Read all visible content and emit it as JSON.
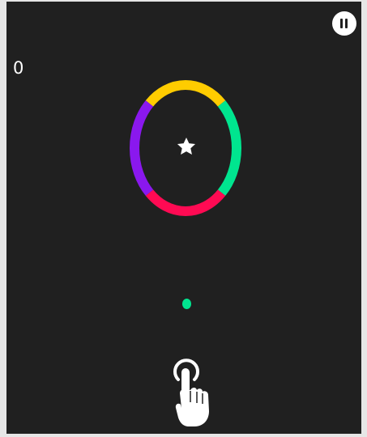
{
  "game": {
    "score": "0",
    "ring_colors": {
      "top": "#ffcc00",
      "right": "#00e58f",
      "bottom": "#ff0a53",
      "left": "#8a18ee"
    },
    "player_ball_color": "#00e58f",
    "background_color": "#202020"
  },
  "icons": {
    "pause": "pause-icon",
    "star": "star-icon",
    "tap_hint": "tap-hand-icon"
  }
}
